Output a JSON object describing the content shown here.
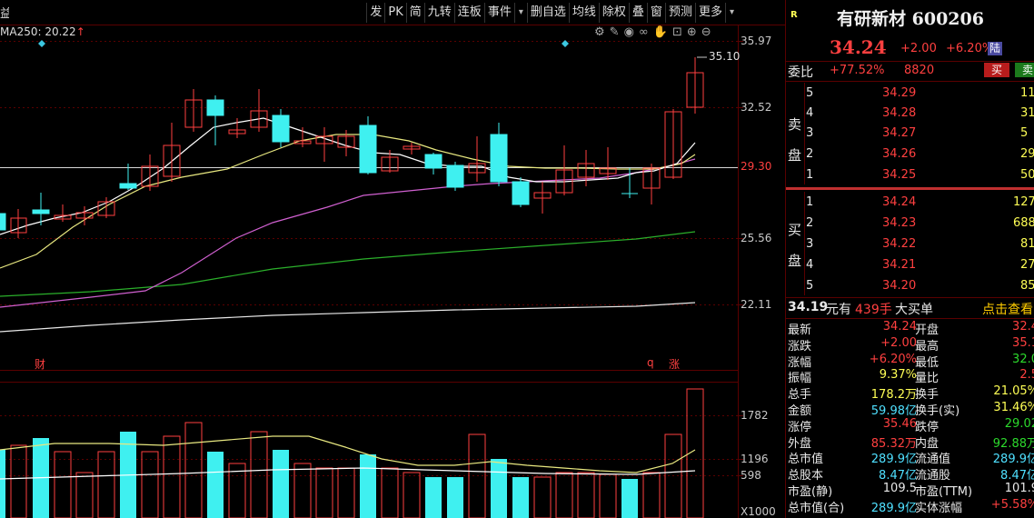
{
  "toolbar": {
    "items": [
      "发",
      "PK",
      "简",
      "九转",
      "连板",
      "事件",
      "▾",
      "删自选",
      "均线",
      "除权",
      "叠",
      "窗",
      "预测",
      "更多",
      "▾"
    ],
    "left_fragment": "益"
  },
  "chart": {
    "ma_label": "MA250: 20.22",
    "ma_arrow": "↑",
    "price_axis": [
      "35.97",
      "32.52",
      "29.30",
      "25.56",
      "22.11"
    ],
    "high_marker": "35.10",
    "events": [
      "财",
      "q",
      "涨"
    ],
    "volume_axis": [
      "1782",
      "1196",
      "598"
    ],
    "volume_unit": "X1000"
  },
  "stock": {
    "badge": "R",
    "name": "有研新材",
    "code": "600206",
    "price": "34.24",
    "change": "+2.00",
    "change_pct": "+6.20%",
    "market_tag": "陆"
  },
  "commission": {
    "label": "委比",
    "ratio": "+77.52%",
    "diff": "8820",
    "buy_button": "买",
    "sell_button": "卖"
  },
  "ask_label": [
    "卖",
    "盘"
  ],
  "bid_label": [
    "买",
    "盘"
  ],
  "asks": [
    {
      "level": "5",
      "price": "34.29",
      "volume": "11"
    },
    {
      "level": "4",
      "price": "34.28",
      "volume": "31"
    },
    {
      "level": "3",
      "price": "34.27",
      "volume": "5"
    },
    {
      "level": "2",
      "price": "34.26",
      "volume": "29"
    },
    {
      "level": "1",
      "price": "34.25",
      "volume": "50"
    }
  ],
  "bids": [
    {
      "level": "1",
      "price": "34.24",
      "volume": "127"
    },
    {
      "level": "2",
      "price": "34.23",
      "volume": "688"
    },
    {
      "level": "3",
      "price": "34.22",
      "volume": "81"
    },
    {
      "level": "4",
      "price": "34.21",
      "volume": "27"
    },
    {
      "level": "5",
      "price": "34.20",
      "volume": "85"
    }
  ],
  "big_order": {
    "price": "34.19",
    "unit": "元有",
    "shares": "439手",
    "label": "大买单",
    "link": "点击查看"
  },
  "stats": [
    {
      "l1": "最新",
      "v1": "34.24",
      "c1": "red",
      "l2": "开盘",
      "v2": "32.4",
      "c2": "red"
    },
    {
      "l1": "涨跌",
      "v1": "+2.00",
      "c1": "red",
      "l2": "最高",
      "v2": "35.1",
      "c2": "red"
    },
    {
      "l1": "涨幅",
      "v1": "+6.20%",
      "c1": "red",
      "l2": "最低",
      "v2": "32.0",
      "c2": "green"
    },
    {
      "l1": "振幅",
      "v1": "9.37%",
      "c1": "yellow",
      "l2": "量比",
      "v2": "2.5",
      "c2": "red"
    },
    {
      "l1": "总手",
      "v1": "178.2万",
      "c1": "yellow",
      "l2": "换手",
      "v2": "21.05%",
      "c2": "yellow"
    },
    {
      "l1": "金额",
      "v1": "59.98亿",
      "c1": "cyan",
      "l2": "换手(实)",
      "v2": "31.46%",
      "c2": "yellow"
    },
    {
      "l1": "涨停",
      "v1": "35.46",
      "c1": "red",
      "l2": "跌停",
      "v2": "29.02",
      "c2": "green"
    },
    {
      "l1": "外盘",
      "v1": "85.32万",
      "c1": "red",
      "l2": "内盘",
      "v2": "92.88万",
      "c2": "green"
    },
    {
      "l1": "总市值",
      "v1": "289.9亿",
      "c1": "cyan",
      "l2": "流通值",
      "v2": "289.9亿",
      "c2": "cyan"
    },
    {
      "l1": "总股本",
      "v1": "8.47亿",
      "c1": "cyan",
      "l2": "流通股",
      "v2": "8.47亿",
      "c2": "cyan"
    },
    {
      "l1": "市盈(静)",
      "v1": "109.5",
      "c1": "white",
      "l2": "市盈(TTM)",
      "v2": "101.9",
      "c2": "white"
    },
    {
      "l1": "总市值(合)",
      "v1": "289.9亿",
      "c1": "cyan",
      "l2": "实体涨幅",
      "v2": "+5.58%",
      "c2": "red"
    }
  ]
}
